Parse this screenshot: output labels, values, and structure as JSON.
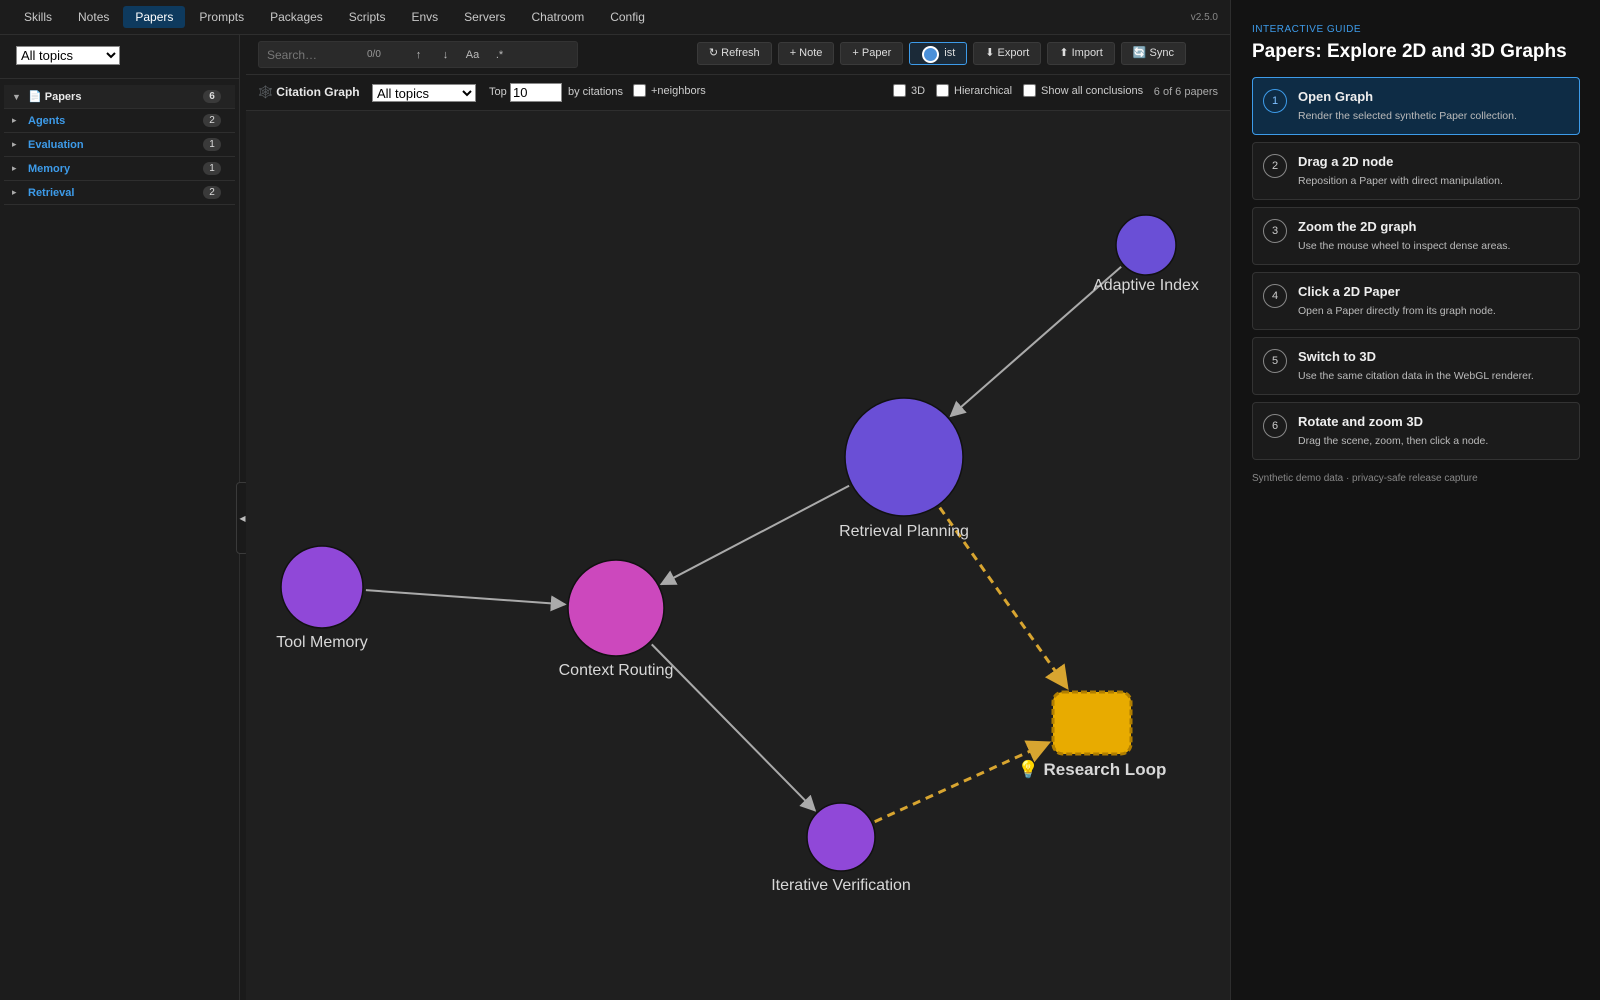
{
  "nav": {
    "tabs": [
      "Skills",
      "Notes",
      "Papers",
      "Prompts",
      "Packages",
      "Scripts",
      "Envs",
      "Servers",
      "Chatroom",
      "Config"
    ],
    "active": "Papers",
    "version": "v2.5.0"
  },
  "sidebar": {
    "topic_select": "All topics",
    "root": {
      "label": "📄 Papers",
      "count": "6"
    },
    "items": [
      {
        "label": "Agents",
        "count": "2"
      },
      {
        "label": "Evaluation",
        "count": "1"
      },
      {
        "label": "Memory",
        "count": "1"
      },
      {
        "label": "Retrieval",
        "count": "2"
      }
    ],
    "collapse_glyph": "◀"
  },
  "toolbar": {
    "search_placeholder": "Search…",
    "search_count": "0/0",
    "prev": "↑",
    "next": "↓",
    "match_case": "Aa",
    "regex": ".*",
    "refresh": "↻ Refresh",
    "note": "+ Note",
    "paper": "+ Paper",
    "list": "ist",
    "export": "⬇ Export",
    "import": "⬆ Import",
    "sync": "🔄 Sync"
  },
  "graph_controls": {
    "title": "🕸️ Citation Graph",
    "topic_select": "All topics",
    "top_label": "Top",
    "top_value": "10",
    "by_citations": "by citations",
    "neighbors": "+neighbors",
    "three_d": "3D",
    "hierarchical": "Hierarchical",
    "show_conclusions": "Show all conclusions",
    "paper_count": "6 of 6 papers"
  },
  "graph": {
    "nodes": [
      {
        "id": "adaptive-index",
        "label": "Adaptive Index",
        "color": "#6a4fd6"
      },
      {
        "id": "retrieval-planning",
        "label": "Retrieval Planning",
        "color": "#6a4fd6"
      },
      {
        "id": "tool-memory",
        "label": "Tool Memory",
        "color": "#9048d8"
      },
      {
        "id": "context-routing",
        "label": "Context Routing",
        "color": "#cc48bd"
      },
      {
        "id": "iterative-verification",
        "label": "Iterative Verification",
        "color": "#9048d8"
      },
      {
        "id": "research-loop",
        "label": "💡 Research Loop",
        "color": "#e8ab00"
      }
    ],
    "edges": [
      {
        "from": "adaptive-index",
        "to": "retrieval-planning",
        "style": "solid"
      },
      {
        "from": "retrieval-planning",
        "to": "context-routing",
        "style": "solid"
      },
      {
        "from": "tool-memory",
        "to": "context-routing",
        "style": "solid"
      },
      {
        "from": "context-routing",
        "to": "iterative-verification",
        "style": "solid"
      },
      {
        "from": "retrieval-planning",
        "to": "research-loop",
        "style": "dashed"
      },
      {
        "from": "iterative-verification",
        "to": "research-loop",
        "style": "dashed"
      }
    ],
    "edge_color": "#aaaaaa",
    "dashed_edge_color": "#d8a530"
  },
  "guide": {
    "kicker": "Interactive guide",
    "title": "Papers: Explore 2D and 3D Graphs",
    "steps": [
      {
        "num": "1",
        "title": "Open Graph",
        "desc": "Render the selected synthetic Paper collection."
      },
      {
        "num": "2",
        "title": "Drag a 2D node",
        "desc": "Reposition a Paper with direct manipulation."
      },
      {
        "num": "3",
        "title": "Zoom the 2D graph",
        "desc": "Use the mouse wheel to inspect dense areas."
      },
      {
        "num": "4",
        "title": "Click a 2D Paper",
        "desc": "Open a Paper directly from its graph node."
      },
      {
        "num": "5",
        "title": "Switch to 3D",
        "desc": "Use the same citation data in the WebGL renderer."
      },
      {
        "num": "6",
        "title": "Rotate and zoom 3D",
        "desc": "Drag the scene, zoom, then click a node."
      }
    ],
    "footer": "Synthetic demo data · privacy-safe release capture"
  }
}
